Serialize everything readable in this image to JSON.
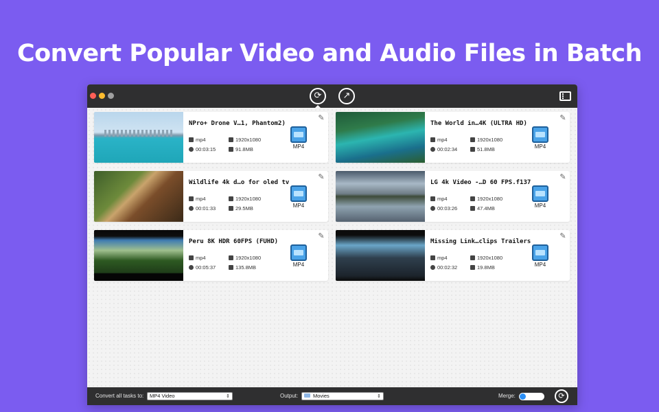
{
  "headline": "Convert Popular Video and Audio Files in Batch",
  "window": {
    "toolbar": {
      "convert_icon": "convert-icon",
      "share_icon": "share-icon",
      "film_icon": "film-strip-icon"
    },
    "videos": [
      {
        "title": "NPro+ Drone V…1, Phantom2)",
        "format": "mp4",
        "resolution": "1920x1080",
        "duration": "00:03:15",
        "size": "91.8MB",
        "output": "MP4"
      },
      {
        "title": "The World in…4K (ULTRA HD)",
        "format": "mp4",
        "resolution": "1920x1080",
        "duration": "00:02:34",
        "size": "51.8MB",
        "output": "MP4"
      },
      {
        "title": "Wildlife 4k d…o for oled tv",
        "format": "mp4",
        "resolution": "1920x1080",
        "duration": "00:01:33",
        "size": "29.5MB",
        "output": "MP4"
      },
      {
        "title": "LG 4k Video -…D 60 FPS.f137",
        "format": "mp4",
        "resolution": "1920x1080",
        "duration": "00:03:26",
        "size": "47.4MB",
        "output": "MP4"
      },
      {
        "title": "Peru 8K HDR 60FPS (FUHD)",
        "format": "mp4",
        "resolution": "1920x1080",
        "duration": "00:05:37",
        "size": "135.8MB",
        "output": "MP4"
      },
      {
        "title": "Missing Link…clips Trailers",
        "format": "mp4",
        "resolution": "1920x1080",
        "duration": "00:02:32",
        "size": "19.8MB",
        "output": "MP4"
      }
    ],
    "bottom": {
      "convert_all_label": "Convert all tasks to:",
      "convert_all_value": "MP4 Video",
      "output_label": "Output:",
      "output_value": "Movies",
      "merge_label": "Merge:",
      "merge_on": false
    }
  }
}
